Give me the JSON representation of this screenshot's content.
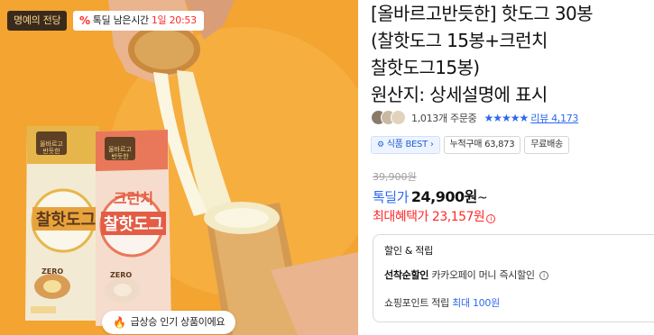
{
  "hero": {
    "brand_badge": "명예의 전당",
    "timer_percent_icon": "%",
    "timer_label": "톡딜 남은시간",
    "timer_value": "1일 20:53",
    "package_brand_1": "올바르고\n반듯한",
    "package_name_1": "찰핫도그",
    "package_name_2": "크런치\n찰핫도그",
    "trend_icon": "fire-icon",
    "trend_text": "급상승 인기 상품이에요"
  },
  "product": {
    "title_lines": [
      "[올바르고반듯한] 핫도그 30봉",
      "(찰핫도그 15봉+크런치",
      "찰핫도그15봉)",
      "원산지: 상세설명에 표시"
    ],
    "order_count": "1,013개 주문중",
    "stars": "★★★★★",
    "review_link": "리뷰 4,173",
    "badges": {
      "best": "식품 BEST",
      "cumulative": "누적구매 63,873",
      "shipping": "무료배송"
    },
    "original_price": "39,900원",
    "deal_label": "톡딜가",
    "deal_price": "24,900원",
    "deal_suffix": "~",
    "max_label": "최대혜택가",
    "max_price": "23,157원",
    "benefits": {
      "heading": "할인 & 적립",
      "first_come_label": "선착순할인",
      "first_come_value": "카카오페이 머니 즉시할인",
      "point_label": "쇼핑포인트 적립",
      "point_max": "최대 100원"
    }
  },
  "colors": {
    "accent_blue": "#2d68f0",
    "accent_red": "#ff2a2a",
    "hero_background": "#f3a431"
  }
}
